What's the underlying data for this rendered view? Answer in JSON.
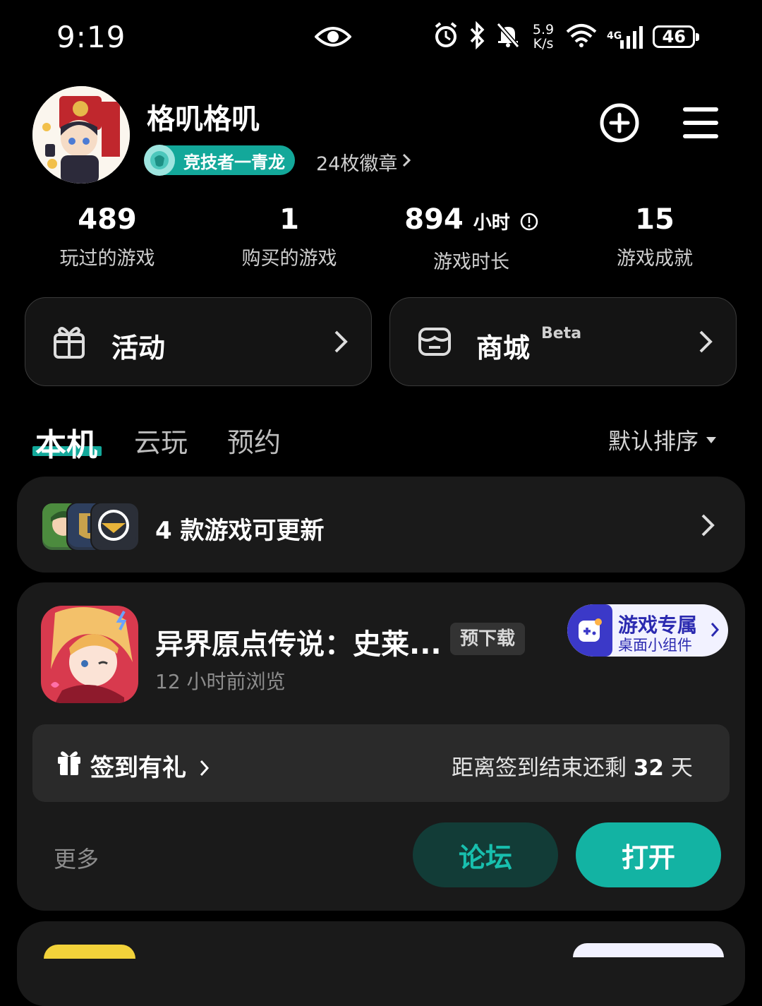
{
  "status_bar": {
    "time": "9:19",
    "net_speed_top": "5.9",
    "net_speed_bottom": "K/s",
    "network": "4G",
    "battery": "46"
  },
  "profile": {
    "username": "格叽格叽",
    "rank": "竞技者一青龙",
    "badges": "24枚徽章"
  },
  "stats": [
    {
      "value": "489",
      "unit": "",
      "label": "玩过的游戏"
    },
    {
      "value": "1",
      "unit": "",
      "label": "购买的游戏"
    },
    {
      "value": "894",
      "unit": "小时",
      "label": "游戏时长"
    },
    {
      "value": "15",
      "unit": "",
      "label": "游戏成就"
    }
  ],
  "entries": {
    "activity": "活动",
    "store": "商城",
    "store_tag": "Beta"
  },
  "tabs": {
    "local": "本机",
    "cloud": "云玩",
    "reserve": "预约",
    "sort": "默认排序"
  },
  "update_row": {
    "text": "4 款游戏可更新"
  },
  "game": {
    "title": "异界原点传说：史莱...",
    "tag": "预下载",
    "viewed": "12 小时前浏览",
    "widget_title": "游戏专属",
    "widget_sub": "桌面小组件",
    "checkin_label": "签到有礼",
    "checkin_prefix": "距离签到结束还剩",
    "checkin_days": "32",
    "checkin_suffix": "天",
    "more": "更多",
    "forum_btn": "论坛",
    "open_btn": "打开"
  },
  "colors": {
    "accent": "#13b3a3",
    "background": "#000000",
    "card": "#1a1a1a"
  }
}
